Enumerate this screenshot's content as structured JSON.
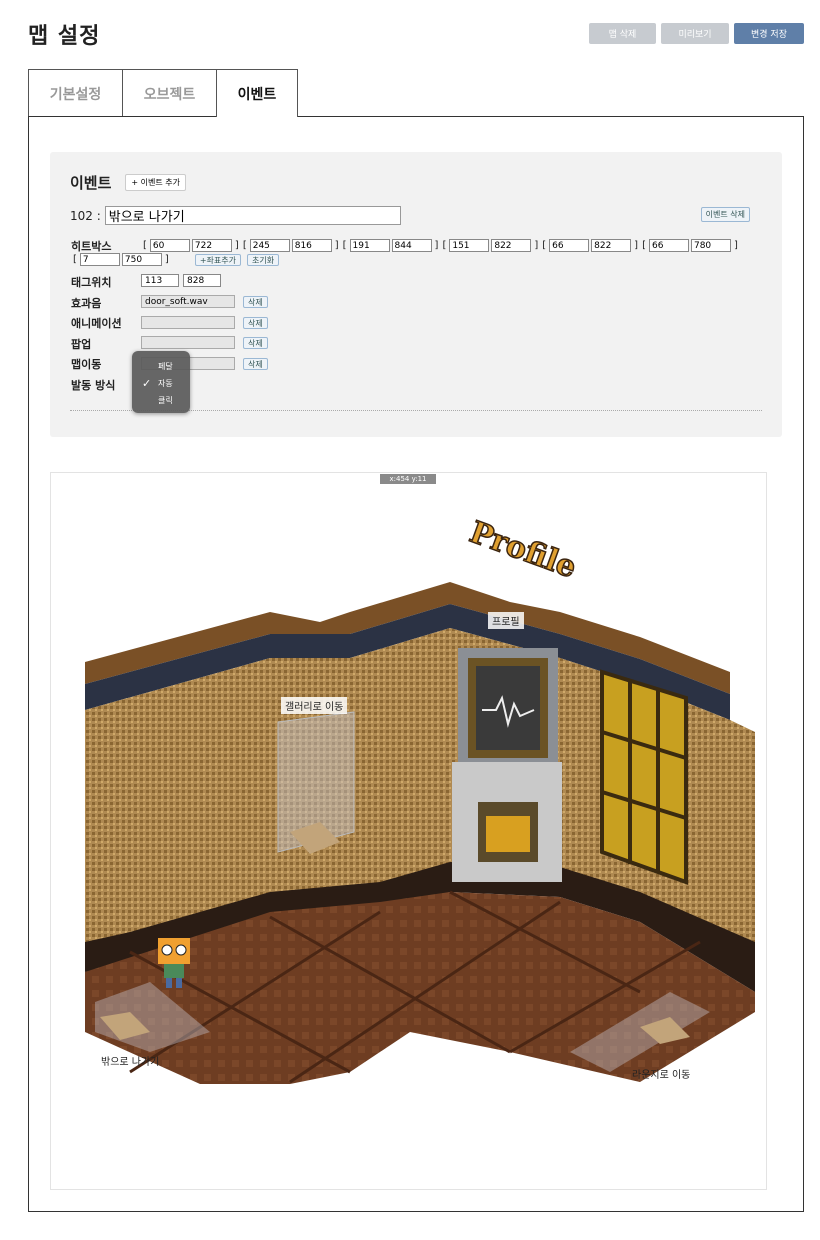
{
  "page": {
    "title": "맵 설정",
    "buttons": {
      "delete_map": "맵 삭제",
      "preview": "미리보기",
      "save": "변경 저장"
    }
  },
  "tabs": [
    {
      "label": "기본설정",
      "active": false
    },
    {
      "label": "오브젝트",
      "active": false
    },
    {
      "label": "이벤트",
      "active": true
    }
  ],
  "event": {
    "heading": "이벤트",
    "add_label": "+ 이벤트 추가",
    "id_prefix": "102 :",
    "name": "밖으로 나가기",
    "delete_label": "이벤트 삭제",
    "hitbox_label": "히트박스",
    "hitbox": [
      [
        "60",
        "722"
      ],
      [
        "245",
        "816"
      ],
      [
        "191",
        "844"
      ],
      [
        "151",
        "822"
      ],
      [
        "66",
        "822"
      ],
      [
        "66",
        "780"
      ],
      [
        "7",
        "750"
      ]
    ],
    "add_coord_label": "+좌표추가",
    "reset_label": "초기화",
    "tag_label": "태그위치",
    "tag": [
      "113",
      "828"
    ],
    "sound_label": "효과음",
    "sound_value": "door_soft.wav",
    "animation_label": "애니메이션",
    "animation_value": "",
    "popup_label": "팝업",
    "popup_value": "",
    "move_label": "맵이동",
    "move_value": "",
    "delete_small": "삭제",
    "trigger_label": "발동 방식",
    "trigger_options": [
      "페달",
      "자동",
      "클릭"
    ],
    "trigger_selected": "자동"
  },
  "map": {
    "coord_readout": "x:454 y:11",
    "sign_text": "Profile",
    "labels": {
      "profile": "프로필",
      "gallery": "갤러리로 이동",
      "exit": "밖으로 나가기",
      "lounge": "라운지로 이동"
    }
  },
  "colors": {
    "accent": "#5f7fa8",
    "button_gray": "#c7cbd0",
    "chip_border": "#9bb8d4"
  }
}
